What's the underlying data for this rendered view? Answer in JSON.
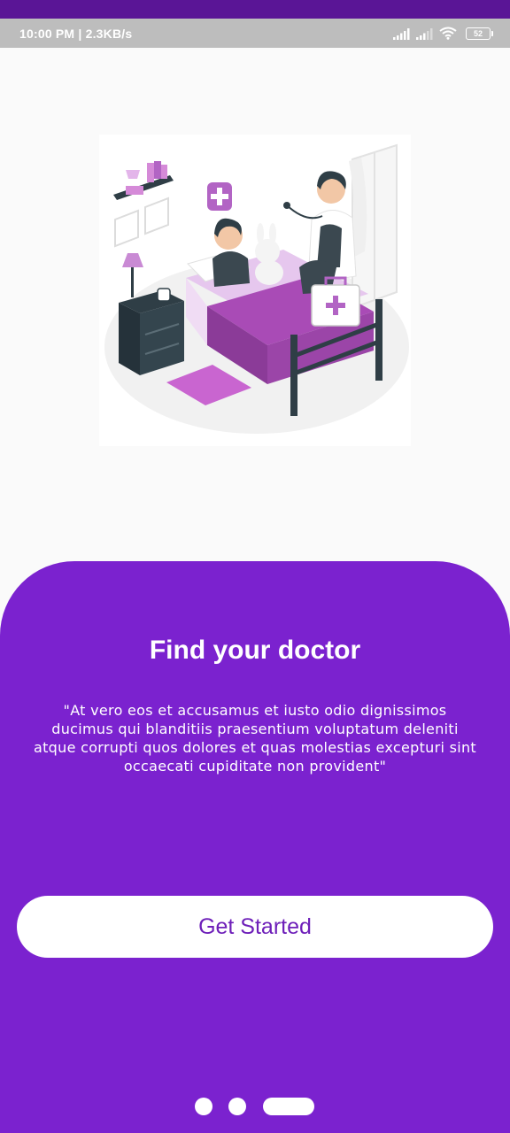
{
  "status_bar": {
    "time_speed": "10:00 PM | 2.3KB/s",
    "battery_level": "52",
    "icons": [
      "cellular-signal-icon",
      "cellular-signal-icon",
      "wifi-icon",
      "battery-icon"
    ]
  },
  "illustration": {
    "icon": "doctor-visiting-child-illustration"
  },
  "onboarding": {
    "title": "Find your doctor",
    "description": "\"At vero eos et accusamus et iusto odio dignissimos ducimus qui blanditiis praesentium voluptatum deleniti atque corrupti quos dolores et quas molestias excepturi sint occaecati cupiditate non provident\"",
    "cta_label": "Get Started",
    "page_count": 3,
    "active_page": 3
  },
  "colors": {
    "primary": "#7b22cf",
    "status_band": "#5a1596",
    "status_bar": "#bdbdbd",
    "button_text": "#6e1fb9",
    "background": "#fafafa"
  }
}
